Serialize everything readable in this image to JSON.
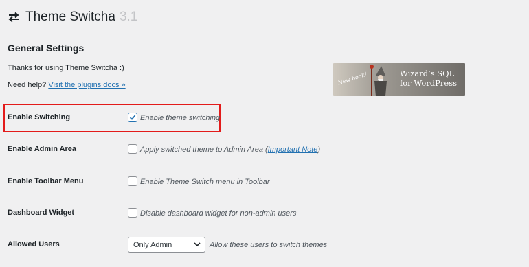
{
  "header": {
    "title": "Theme Switcha",
    "version": "3.1",
    "icon": "swap-arrows-icon"
  },
  "section_title": "General Settings",
  "thanks_text": "Thanks for using Theme Switcha :)",
  "help": {
    "prefix": "Need help?",
    "link": "Visit the plugins docs »"
  },
  "banner": {
    "tag": "New book!",
    "line1": "Wizard’s SQL",
    "line2": "for WordPress"
  },
  "settings": [
    {
      "label": "Enable Switching",
      "option": "Enable theme switching",
      "checked": true
    },
    {
      "label": "Enable Admin Area",
      "option_prefix": "Apply switched theme to Admin Area (",
      "option_link": "Important Note",
      "option_suffix": ")",
      "checked": false
    },
    {
      "label": "Enable Toolbar Menu",
      "option": "Enable Theme Switch menu in Toolbar",
      "checked": false
    },
    {
      "label": "Dashboard Widget",
      "option": "Disable dashboard widget for non-admin users",
      "checked": false
    },
    {
      "label": "Allowed Users",
      "select_value": "Only Admin",
      "option": "Allow these users to switch themes"
    }
  ],
  "colors": {
    "accent": "#2271b1",
    "highlight": "#e31b1b",
    "background": "#f0f0f1"
  }
}
